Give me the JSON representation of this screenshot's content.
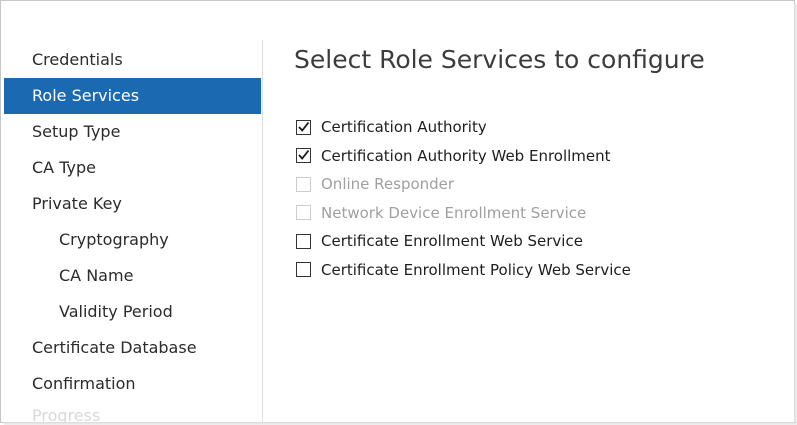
{
  "sidebar": {
    "items": [
      {
        "label": "Credentials"
      },
      {
        "label": "Role Services",
        "selected": true
      },
      {
        "label": "Setup Type"
      },
      {
        "label": "CA Type"
      },
      {
        "label": "Private Key"
      },
      {
        "label": "Cryptography"
      },
      {
        "label": "CA Name"
      },
      {
        "label": "Validity Period"
      },
      {
        "label": "Certificate Database"
      },
      {
        "label": "Confirmation"
      },
      {
        "label": "Progress"
      }
    ]
  },
  "main": {
    "title": "Select Role Services to configure",
    "options": [
      {
        "label": "Certification Authority",
        "checked": true,
        "enabled": true
      },
      {
        "label": "Certification Authority Web Enrollment",
        "checked": true,
        "enabled": true
      },
      {
        "label": "Online Responder",
        "checked": false,
        "enabled": false
      },
      {
        "label": "Network Device Enrollment Service",
        "checked": false,
        "enabled": false
      },
      {
        "label": "Certificate Enrollment Web Service",
        "checked": false,
        "enabled": true
      },
      {
        "label": "Certificate Enrollment Policy Web Service",
        "checked": false,
        "enabled": true
      }
    ]
  },
  "colors": {
    "selected_bg": "#1b6ab1",
    "selected_text": "#ffffff",
    "disabled_text": "#a0a0a0"
  }
}
